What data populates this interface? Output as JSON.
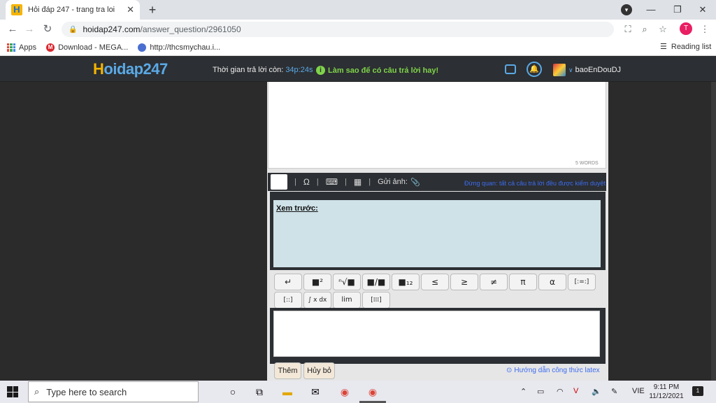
{
  "browser": {
    "tab_title": "Hỏi đáp 247 - trang tra loi",
    "url_host": "hoidap247.com",
    "url_path": "/answer_question/2961050",
    "profile_initial": "T",
    "bookmarks": [
      "Apps",
      "Download - MEGA...",
      "http://thcsmychau.i..."
    ],
    "reading_list": "Reading list"
  },
  "site": {
    "logo_h": "H",
    "logo_rest": "oidap247",
    "timer_label": "Thời gian trả lời còn: ",
    "timer_value": "34p:24s",
    "tip": "Làm sao để có câu trả lời hay!",
    "username": "baoEnDouDJ"
  },
  "editor": {
    "word_count": "5 WORDS",
    "upload_label": "Gửi ảnh:",
    "review_note": "Đừng quan: tất cả câu trả lời đều được kiểm duyệt",
    "preview_label": "Xem trước:",
    "keys": [
      "↵",
      "■²",
      "ⁿ√■",
      "■/■",
      "■₁₂",
      "≤",
      "≥",
      "≠",
      "π",
      "α",
      "[:=:]",
      "[::]",
      "∫ x dx",
      "lim",
      "[⁞⁞⁞]"
    ],
    "add_button": "Thêm",
    "cancel_button": "Hủy bỏ",
    "guide_link": "Hướng dẫn công thức latex"
  },
  "taskbar": {
    "search_placeholder": "Type here to search",
    "language": "VIE",
    "time": "9:11 PM",
    "date": "11/12/2021",
    "notif_count": "1"
  }
}
